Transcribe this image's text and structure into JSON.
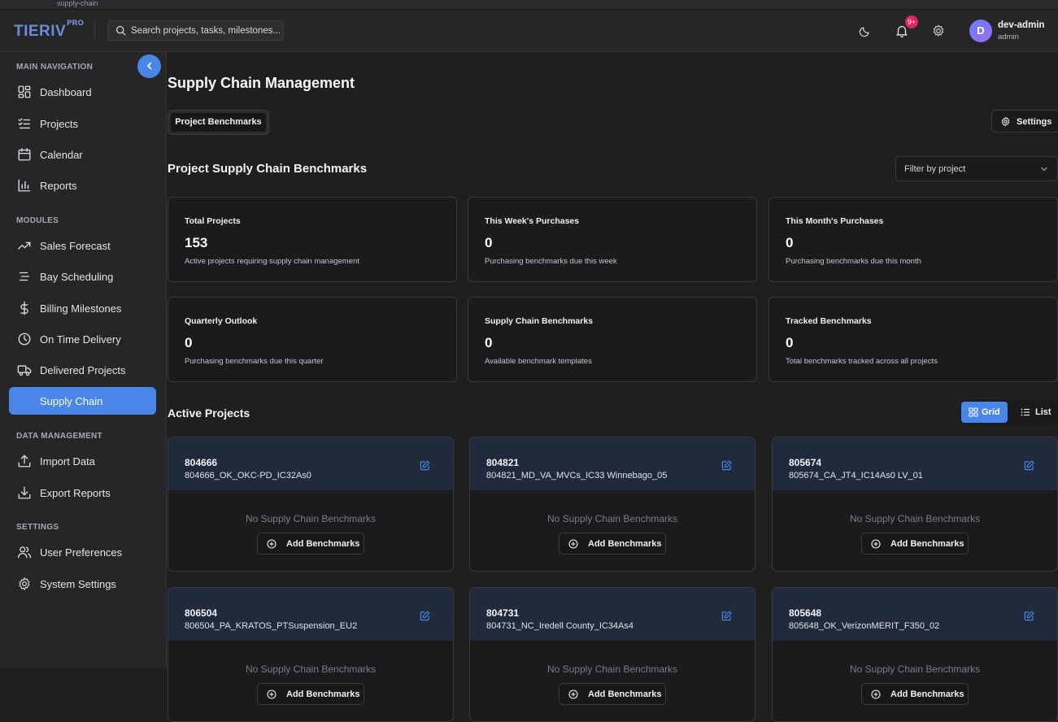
{
  "browser": {
    "url_fragment": "supply-chain"
  },
  "header": {
    "logo": "TIERIV",
    "logo_sup": "PRO",
    "search_placeholder": "Search projects, tasks, milestones...",
    "notifications_badge": "9+",
    "user": {
      "initial": "D",
      "name": "dev-admin",
      "role": "admin"
    }
  },
  "sidebar": {
    "sections": [
      {
        "title": "MAIN NAVIGATION",
        "items": [
          {
            "label": "Dashboard",
            "icon": "dashboard-icon"
          },
          {
            "label": "Projects",
            "icon": "checklist-icon"
          },
          {
            "label": "Calendar",
            "icon": "calendar-icon"
          },
          {
            "label": "Reports",
            "icon": "bar-chart-icon"
          }
        ]
      },
      {
        "title": "MODULES",
        "items": [
          {
            "label": "Sales Forecast",
            "icon": "trending-up-icon"
          },
          {
            "label": "Bay Scheduling",
            "icon": "list-icon"
          },
          {
            "label": "Billing Milestones",
            "icon": "dollar-icon"
          },
          {
            "label": "On Time Delivery",
            "icon": "clock-icon"
          },
          {
            "label": "Delivered Projects",
            "icon": "truck-icon"
          },
          {
            "label": "Supply Chain",
            "icon": "supply-chain-icon",
            "active": true
          }
        ]
      },
      {
        "title": "DATA MANAGEMENT",
        "items": [
          {
            "label": "Import Data",
            "icon": "upload-icon"
          },
          {
            "label": "Export Reports",
            "icon": "download-icon"
          }
        ]
      },
      {
        "title": "SETTINGS",
        "items": [
          {
            "label": "User Preferences",
            "icon": "users-icon"
          },
          {
            "label": "System Settings",
            "icon": "gear-icon"
          }
        ]
      }
    ]
  },
  "main": {
    "title": "Supply Chain Management",
    "tab": "Project Benchmarks",
    "settings_label": "Settings",
    "section_title": "Project Supply Chain Benchmarks",
    "filter_placeholder": "Filter by project",
    "stats": [
      {
        "title": "Total Projects",
        "value": "153",
        "desc": "Active projects requiring supply chain management"
      },
      {
        "title": "This Week's Purchases",
        "value": "0",
        "desc": "Purchasing benchmarks due this week"
      },
      {
        "title": "This Month's Purchases",
        "value": "0",
        "desc": "Purchasing benchmarks due this month"
      },
      {
        "title": "Quarterly Outlook",
        "value": "0",
        "desc": "Purchasing benchmarks due this quarter"
      },
      {
        "title": "Supply Chain Benchmarks",
        "value": "0",
        "desc": "Available benchmark templates"
      },
      {
        "title": "Tracked Benchmarks",
        "value": "0",
        "desc": "Total benchmarks tracked across all projects"
      }
    ],
    "active_projects_title": "Active Projects",
    "view_toggle": {
      "grid": "Grid",
      "list": "List",
      "selected": "Grid"
    },
    "projects": [
      {
        "id": "804666",
        "name": "804666_OK_OKC-PD_IC32As0",
        "empty": "No Supply Chain Benchmarks",
        "add": "Add Benchmarks"
      },
      {
        "id": "804821",
        "name": "804821_MD_VA_MVCs_IC33 Winnebago_05",
        "empty": "No Supply Chain Benchmarks",
        "add": "Add Benchmarks"
      },
      {
        "id": "805674",
        "name": "805674_CA_JT4_IC14As0 LV_01",
        "empty": "No Supply Chain Benchmarks",
        "add": "Add Benchmarks"
      },
      {
        "id": "806504",
        "name": "806504_PA_KRATOS_PTSuspension_EU2",
        "empty": "No Supply Chain Benchmarks",
        "add": "Add Benchmarks"
      },
      {
        "id": "804731",
        "name": "804731_NC_Iredell County_IC34As4",
        "empty": "No Supply Chain Benchmarks",
        "add": "Add Benchmarks"
      },
      {
        "id": "805648",
        "name": "805648_OK_VerizonMERIT_F350_02",
        "empty": "No Supply Chain Benchmarks",
        "add": "Add Benchmarks"
      }
    ]
  },
  "colors": {
    "accent": "#4a86e8",
    "badge": "#e0245e",
    "card_header": "#1f2a3d"
  }
}
